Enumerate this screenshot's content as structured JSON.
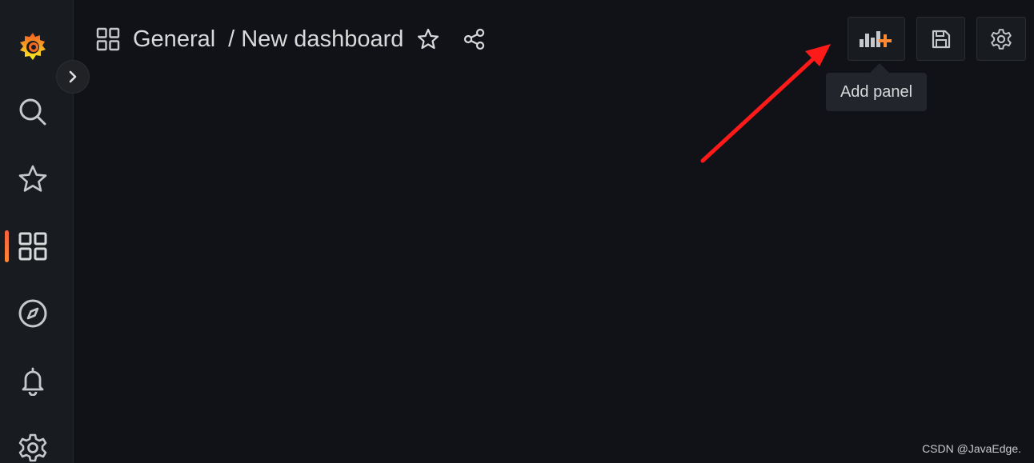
{
  "breadcrumb": {
    "folder": "General",
    "separator": "/",
    "dashboard": "New dashboard"
  },
  "toolbar": {
    "add_panel_tooltip": "Add panel"
  },
  "sidebar": {
    "active_item": "dashboards",
    "items": [
      {
        "name": "search",
        "icon": "search-icon"
      },
      {
        "name": "starred",
        "icon": "star-icon"
      },
      {
        "name": "dashboards",
        "icon": "apps-icon"
      },
      {
        "name": "explore",
        "icon": "compass-icon"
      },
      {
        "name": "alerting",
        "icon": "bell-icon"
      },
      {
        "name": "configuration",
        "icon": "gear-icon"
      }
    ]
  },
  "colors": {
    "background": "#111217",
    "sidebar": "#181b1f",
    "text": "#d8d9da",
    "accent": "#ff8833",
    "annotation_arrow": "#ff1a1a"
  },
  "watermark": "CSDN @JavaEdge."
}
